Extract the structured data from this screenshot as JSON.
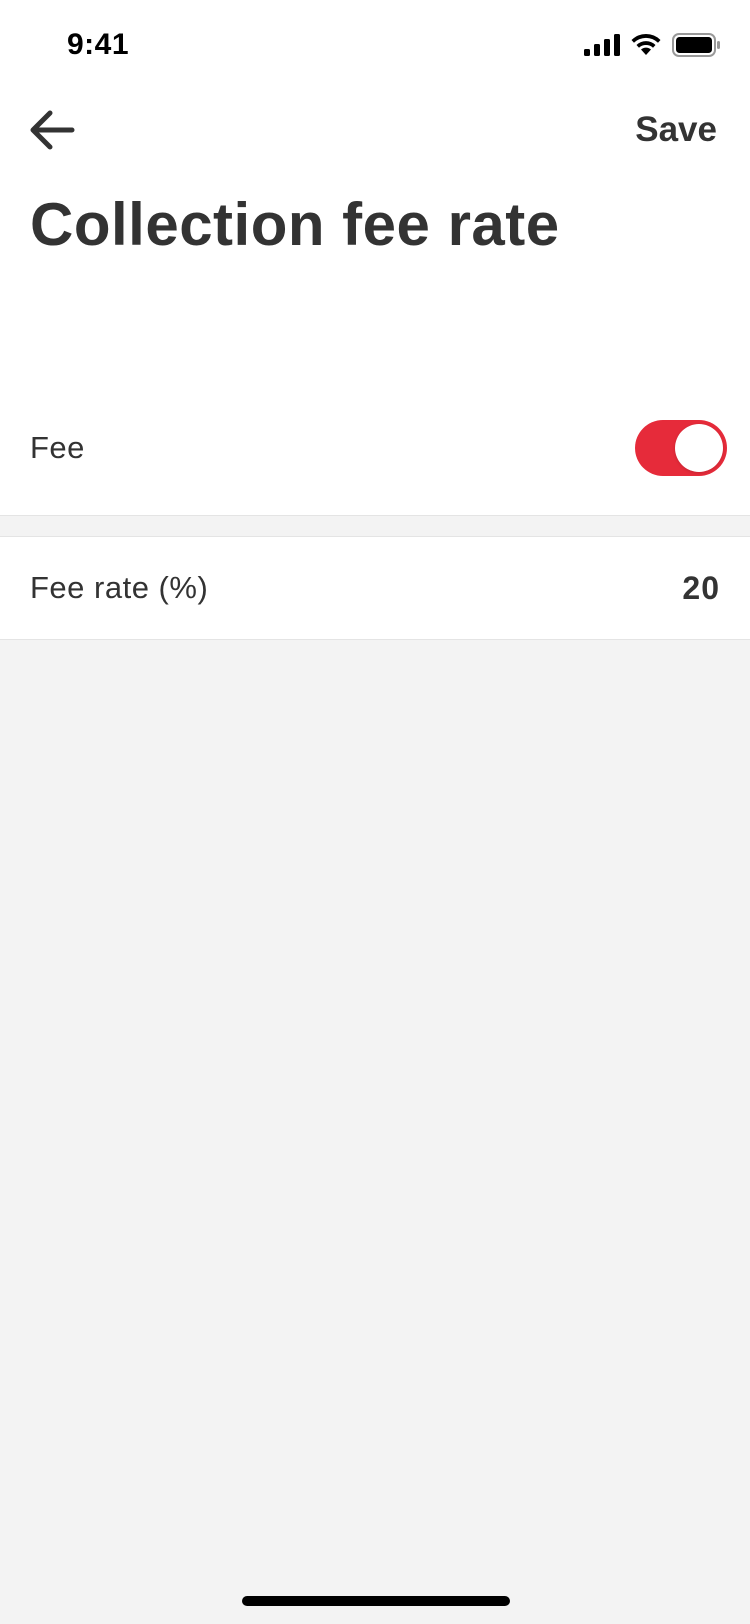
{
  "status_bar": {
    "time": "9:41",
    "icons": [
      "signal-icon",
      "wifi-icon",
      "battery-icon"
    ]
  },
  "nav": {
    "back_icon": "arrow-left-icon",
    "save_label": "Save"
  },
  "page": {
    "title": "Collection fee rate"
  },
  "settings": {
    "fee": {
      "label": "Fee",
      "enabled": true
    },
    "fee_rate": {
      "label": "Fee rate (%)",
      "value": "20"
    }
  },
  "colors": {
    "accent": "#e62b3a",
    "background": "#f3f3f3",
    "text": "#333333"
  }
}
